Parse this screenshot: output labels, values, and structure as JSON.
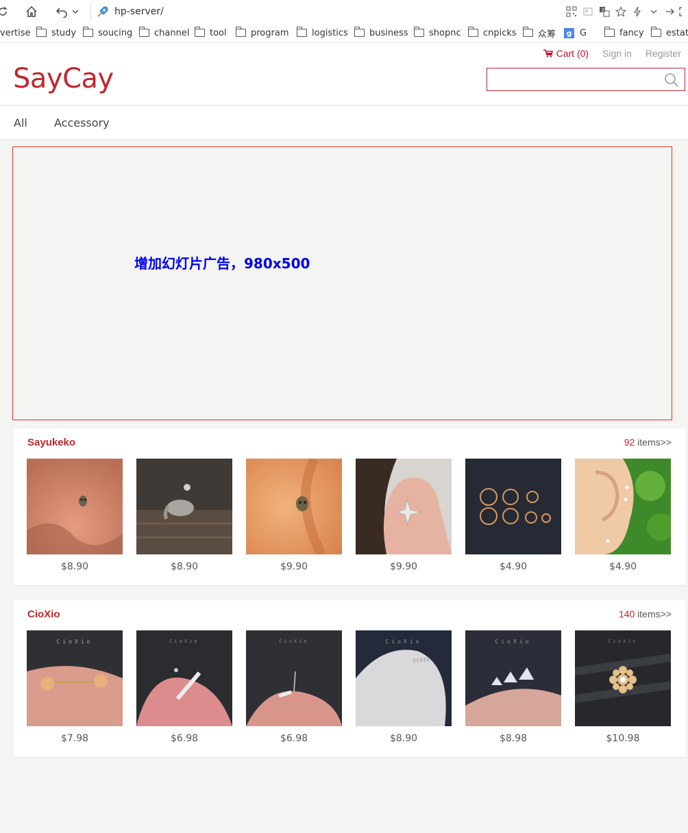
{
  "browser": {
    "url": "hp-server/",
    "bookmarks": [
      {
        "label": "vertise",
        "type": "text"
      },
      {
        "label": "study",
        "type": "folder"
      },
      {
        "label": "soucing",
        "type": "folder"
      },
      {
        "label": "channel",
        "type": "folder"
      },
      {
        "label": "tool",
        "type": "folder"
      },
      {
        "label": "program",
        "type": "folder"
      },
      {
        "label": "logistics",
        "type": "folder"
      },
      {
        "label": "business",
        "type": "folder"
      },
      {
        "label": "shopnc",
        "type": "folder"
      },
      {
        "label": "cnpicks",
        "type": "folder"
      },
      {
        "label": "众筹",
        "type": "folder"
      },
      {
        "label": "G",
        "type": "google"
      },
      {
        "label": "fancy",
        "type": "folder"
      },
      {
        "label": "estate",
        "type": "folder"
      }
    ]
  },
  "header": {
    "cart_label": "Cart (0)",
    "signin_label": "Sign in",
    "register_label": "Register",
    "logo": "SayCay",
    "search_placeholder": ""
  },
  "nav": {
    "items": [
      "All",
      "Accessory"
    ]
  },
  "banner": {
    "text": "增加幻灯片广告，980x500"
  },
  "shops": [
    {
      "name": "Sayukeko",
      "count": "92",
      "more_label": " items>>",
      "items": [
        {
          "price": "$8.90",
          "image": "skull-nose-stud"
        },
        {
          "price": "$8.90",
          "image": "elephant-stud"
        },
        {
          "price": "$9.90",
          "image": "skull-ear-stud"
        },
        {
          "price": "$9.90",
          "image": "star-stud-finger"
        },
        {
          "price": "$4.90",
          "image": "gold-hoops"
        },
        {
          "price": "$4.90",
          "image": "ear-star-studs"
        }
      ]
    },
    {
      "name": "CioXio",
      "count": "140",
      "more_label": " items>>",
      "items": [
        {
          "price": "$7.98",
          "image": "gem-barbell"
        },
        {
          "price": "$6.98",
          "image": "bar-stud"
        },
        {
          "price": "$6.98",
          "image": "small-bar-stud"
        },
        {
          "price": "$8.90",
          "image": "ear-cuff"
        },
        {
          "price": "$8.98",
          "image": "triangle-gems"
        },
        {
          "price": "$10.98",
          "image": "flower-stud"
        }
      ]
    }
  ],
  "watermark": "CioXio",
  "colors": {
    "brand": "#c0272d",
    "banner_text": "#0000ee",
    "banner_border": "#e03030"
  }
}
